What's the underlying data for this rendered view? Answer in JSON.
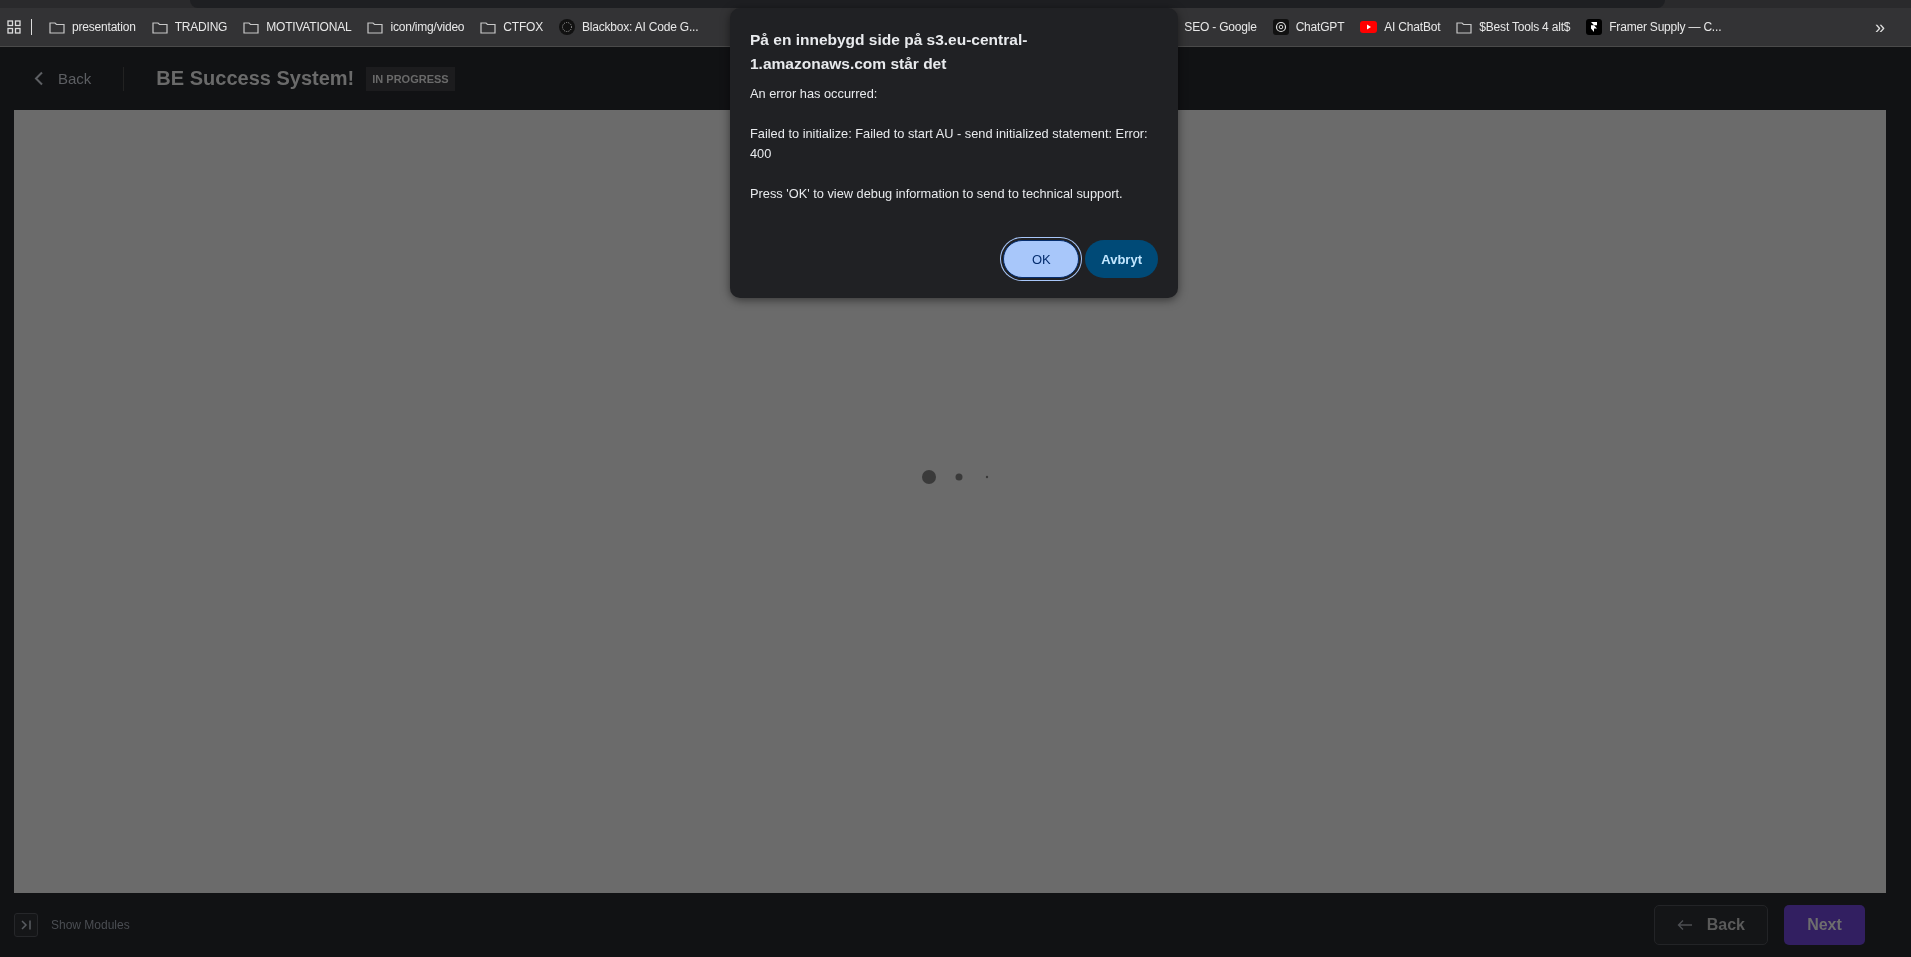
{
  "bookmarks": [
    {
      "label": "presentation",
      "kind": "folder"
    },
    {
      "label": "TRADING",
      "kind": "folder"
    },
    {
      "label": "MOTIVATIONAL",
      "kind": "folder"
    },
    {
      "label": "icon/img/video",
      "kind": "folder"
    },
    {
      "label": "CTFOX",
      "kind": "folder"
    },
    {
      "label": "Blackbox: AI Code G...",
      "kind": "hex-logo"
    },
    {
      "label": "SEO - Google",
      "kind": "plain"
    },
    {
      "label": "ChatGPT",
      "kind": "knot-logo"
    },
    {
      "label": "AI ChatBot",
      "kind": "play-logo"
    },
    {
      "label": "$Best Tools 4  alt$",
      "kind": "folder"
    },
    {
      "label": "Framer Supply — C...",
      "kind": "f-logo"
    }
  ],
  "more_bookmarks": "»",
  "header": {
    "back": "Back",
    "title": "BE Success System!",
    "badge": "IN PROGRESS"
  },
  "dialog": {
    "title": "På en innebygd side på s3.eu-central-1.amazonaws.com står det",
    "paragraphs": [
      "An error has occurred:",
      "Failed to initialize: Failed to start AU -  send initialized statement: Error: 400",
      "Press 'OK' to view debug information to send to technical support."
    ],
    "buttons": [
      {
        "label": "OK",
        "focused": true
      },
      {
        "label": "Avbryt",
        "focused": false
      }
    ]
  },
  "footer": {
    "show_modules": "Show Modules",
    "back": "Back",
    "next": "Next"
  }
}
